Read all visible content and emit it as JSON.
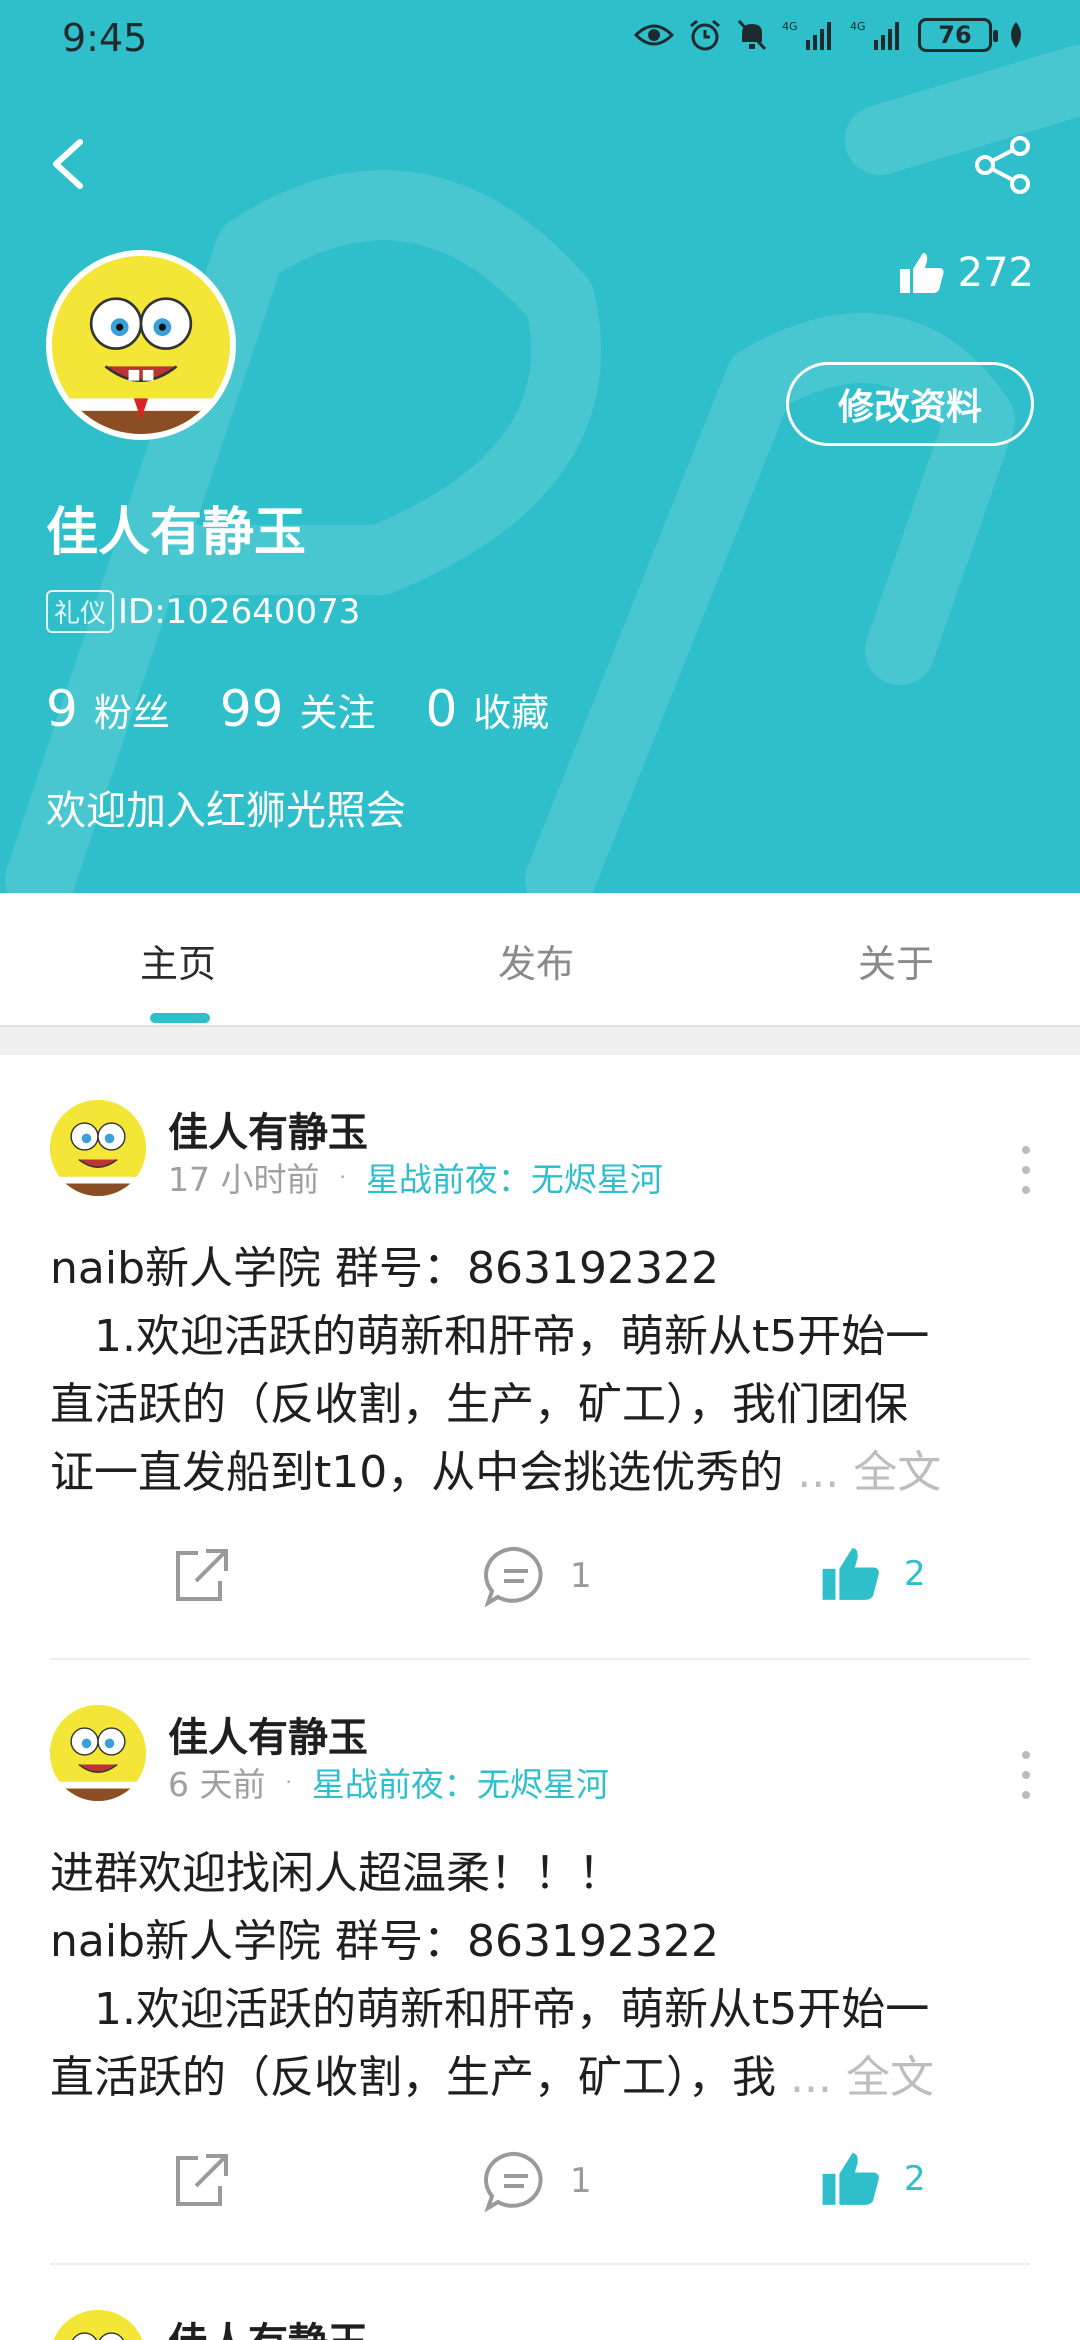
{
  "status": {
    "time": "9:45",
    "battery": "76"
  },
  "colors": {
    "accent": "#2fbfca",
    "text": "#1f1f1f",
    "muted": "#a0a0a0"
  },
  "profile": {
    "likes": "272",
    "edit_label": "修改资料",
    "name": "佳人有静玉",
    "badge": "礼仪",
    "id": "ID:102640073",
    "stats": [
      {
        "num": "9",
        "label": "粉丝"
      },
      {
        "num": "99",
        "label": "关注"
      },
      {
        "num": "0",
        "label": "收藏"
      }
    ],
    "bio": "欢迎加入红狮光照会"
  },
  "tabs": [
    {
      "label": "主页",
      "active": true
    },
    {
      "label": "发布",
      "active": false
    },
    {
      "label": "关于",
      "active": false
    }
  ],
  "posts": [
    {
      "author": "佳人有静玉",
      "time": "17 小时前",
      "dot": "·",
      "game": "星战前夜：无烬星河",
      "lines": [
        "naib新人学院 群号：863192322",
        "　1.欢迎活跃的萌新和肝帝，萌新从t5开始一",
        "直活跃的（反收割，生产，矿工），我们团保",
        "证一直发船到t10，从中会挑选优秀的"
      ],
      "more": "... 全文",
      "comments": "1",
      "likes": "2"
    },
    {
      "author": "佳人有静玉",
      "time": "6 天前",
      "dot": "·",
      "game": "星战前夜：无烬星河",
      "lines": [
        "进群欢迎找闲人超温柔！！！",
        "naib新人学院 群号：863192322",
        "　1.欢迎活跃的萌新和肝帝，萌新从t5开始一",
        "直活跃的（反收割，生产，矿工），我"
      ],
      "more": "... 全文",
      "comments": "1",
      "likes": "2"
    },
    {
      "author": "佳人有静玉"
    }
  ]
}
